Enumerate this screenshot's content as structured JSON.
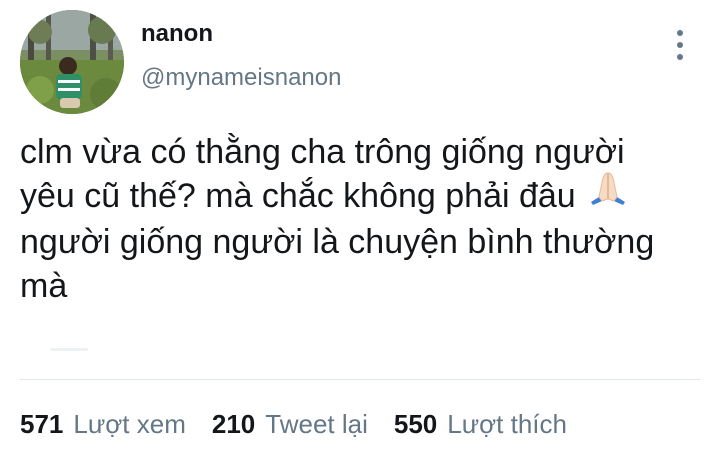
{
  "author": {
    "display_name": "nanon",
    "handle": "@mynameisnanon"
  },
  "tweet": {
    "lines": [
      "clm vừa có thằng cha trông giống người",
      "yêu cũ thế? mà chắc không phải đâu",
      "người giống người là chuyện bình thường",
      "mà"
    ],
    "emoji": "folded-hands"
  },
  "stats": [
    {
      "count": "571",
      "label": "Lượt xem"
    },
    {
      "count": "210",
      "label": "Tweet lại"
    },
    {
      "count": "550",
      "label": "Lượt thích"
    }
  ],
  "icons": {
    "more": "more-vertical-icon"
  },
  "colors": {
    "text_primary": "#14171a",
    "text_secondary": "#657786",
    "divider": "#e1e8ed"
  }
}
